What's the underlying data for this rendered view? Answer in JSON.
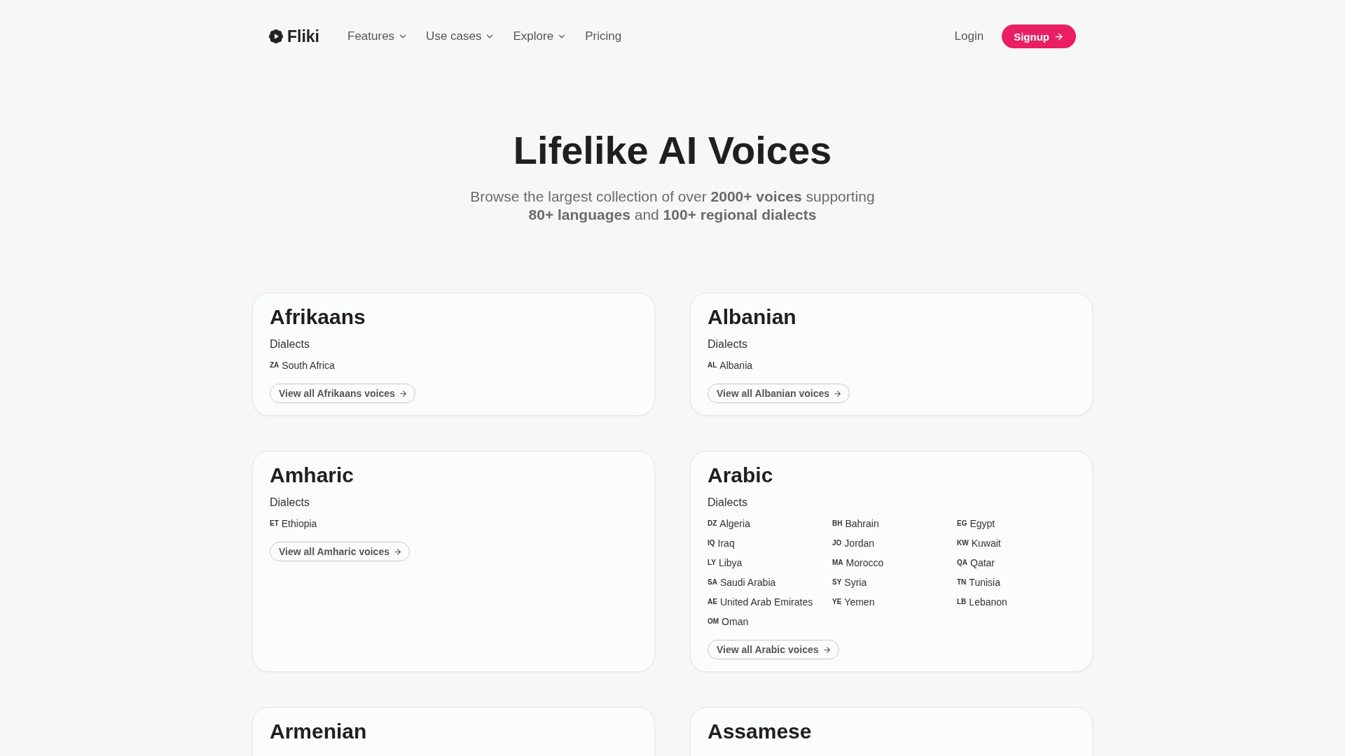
{
  "nav": {
    "logo": "Fliki",
    "menu": [
      {
        "label": "Features",
        "dropdown": true
      },
      {
        "label": "Use cases",
        "dropdown": true
      },
      {
        "label": "Explore",
        "dropdown": true
      },
      {
        "label": "Pricing",
        "dropdown": false
      }
    ],
    "login": "Login",
    "signup": "Signup"
  },
  "hero": {
    "title": "Lifelike AI Voices",
    "subtitle": "Browse the largest collection of over **2000+ voices** supporting **80+ languages** and **100+ regional dialects**"
  },
  "languages": [
    {
      "name": "Afrikaans",
      "dialects_label": "Dialects",
      "dialects": [
        {
          "code": "ZA",
          "name": "South Africa"
        }
      ],
      "link": "View all Afrikaans voices"
    },
    {
      "name": "Albanian",
      "dialects_label": "Dialects",
      "dialects": [
        {
          "code": "AL",
          "name": "Albania"
        }
      ],
      "link": "View all Albanian voices"
    },
    {
      "name": "Amharic",
      "dialects_label": "Dialects",
      "dialects": [
        {
          "code": "ET",
          "name": "Ethiopia"
        }
      ],
      "link": "View all Amharic voices"
    },
    {
      "name": "Arabic",
      "dialects_label": "Dialects",
      "dialects": [
        {
          "code": "DZ",
          "name": "Algeria"
        },
        {
          "code": "BH",
          "name": "Bahrain"
        },
        {
          "code": "EG",
          "name": "Egypt"
        },
        {
          "code": "IQ",
          "name": "Iraq"
        },
        {
          "code": "JO",
          "name": "Jordan"
        },
        {
          "code": "KW",
          "name": "Kuwait"
        },
        {
          "code": "LY",
          "name": "Libya"
        },
        {
          "code": "MA",
          "name": "Morocco"
        },
        {
          "code": "QA",
          "name": "Qatar"
        },
        {
          "code": "SA",
          "name": "Saudi Arabia"
        },
        {
          "code": "SY",
          "name": "Syria"
        },
        {
          "code": "TN",
          "name": "Tunisia"
        },
        {
          "code": "AE",
          "name": "United Arab Emirates"
        },
        {
          "code": "YE",
          "name": "Yemen"
        },
        {
          "code": "LB",
          "name": "Lebanon"
        },
        {
          "code": "OM",
          "name": "Oman"
        }
      ],
      "link": "View all Arabic voices"
    },
    {
      "name": "Armenian"
    },
    {
      "name": "Assamese"
    }
  ]
}
